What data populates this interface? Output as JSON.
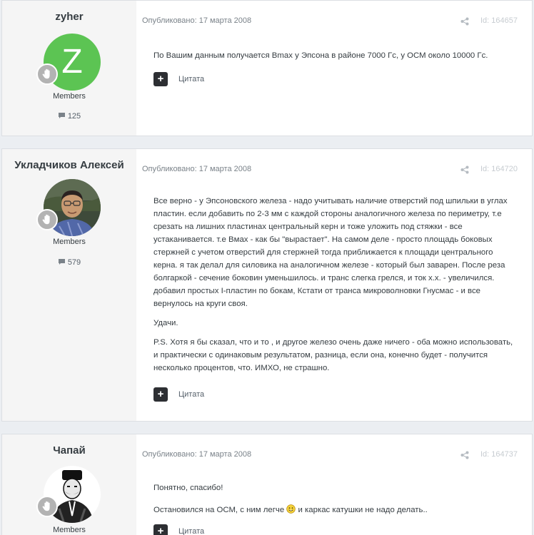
{
  "posts": [
    {
      "author": "zyher",
      "avatar_letter": "Z",
      "avatar_color": "#5cc453",
      "group": "Members",
      "post_count": "125",
      "published": "Опубликовано: 17 марта 2008",
      "id": "Id: 164657",
      "paragraphs": [
        "По Вашим данным получается Bmax у Эпсона в районе 7000 Гс, у ОСМ около 10000 Гс."
      ],
      "quote_label": "Цитата"
    },
    {
      "author": "Укладчиков Алексей",
      "group": "Members",
      "post_count": "579",
      "published": "Опубликовано: 17 марта 2008",
      "id": "Id: 164720",
      "paragraphs": [
        "Все верно - у Эпсоновского железа - надо учитывать наличие отверстий под шпильки в углах пластин. если добавить по 2-3 мм с каждой стороны аналогичного железа по периметру, т.е срезать на лишних пластинах центральный керн и тоже уложить под стяжки - все устаканивается. т.е Bмах - как бы \"вырастает\". На самом деле - просто площадь боковых стержней с учетом отверстий для стержней тогда приближается к площади центрального керна. я так делал для силовика на аналогичном железе - который был заварен. После реза болгаркой - сечение боковин уменьшилось. и транс слегка грелся, и ток х.х. - увеличился. добавил простых I-пластин по бокам, Кстати от транса микроволновки Гнусмас - и все вернулось на круги своя.",
        "Удачи.",
        "P.S. Хотя я бы сказал, что и то , и другое железо очень даже ничего - оба можно использовать, и практически с одинаковым результатом, разница, если она, конечно будет - получится несколько процентов, что. ИМХО, не страшно."
      ],
      "quote_label": "Цитата"
    },
    {
      "author": "Чапай",
      "group": "Members",
      "published": "Опубликовано: 17 марта 2008",
      "id": "Id: 164737",
      "paragraphs": [
        "Понятно, спасибо!"
      ],
      "para2_before": "Остановился на ОСМ, с ним легче",
      "para2_after": " и каркас катушки не надо делать..",
      "quote_label": "Цитата"
    }
  ],
  "icons": {
    "rank": "hand-rank-icon",
    "comment": "comment-bubble-icon",
    "share": "share-icon",
    "plus": "plus-icon",
    "smiley": "smiley-icon"
  },
  "plus_symbol": "+"
}
